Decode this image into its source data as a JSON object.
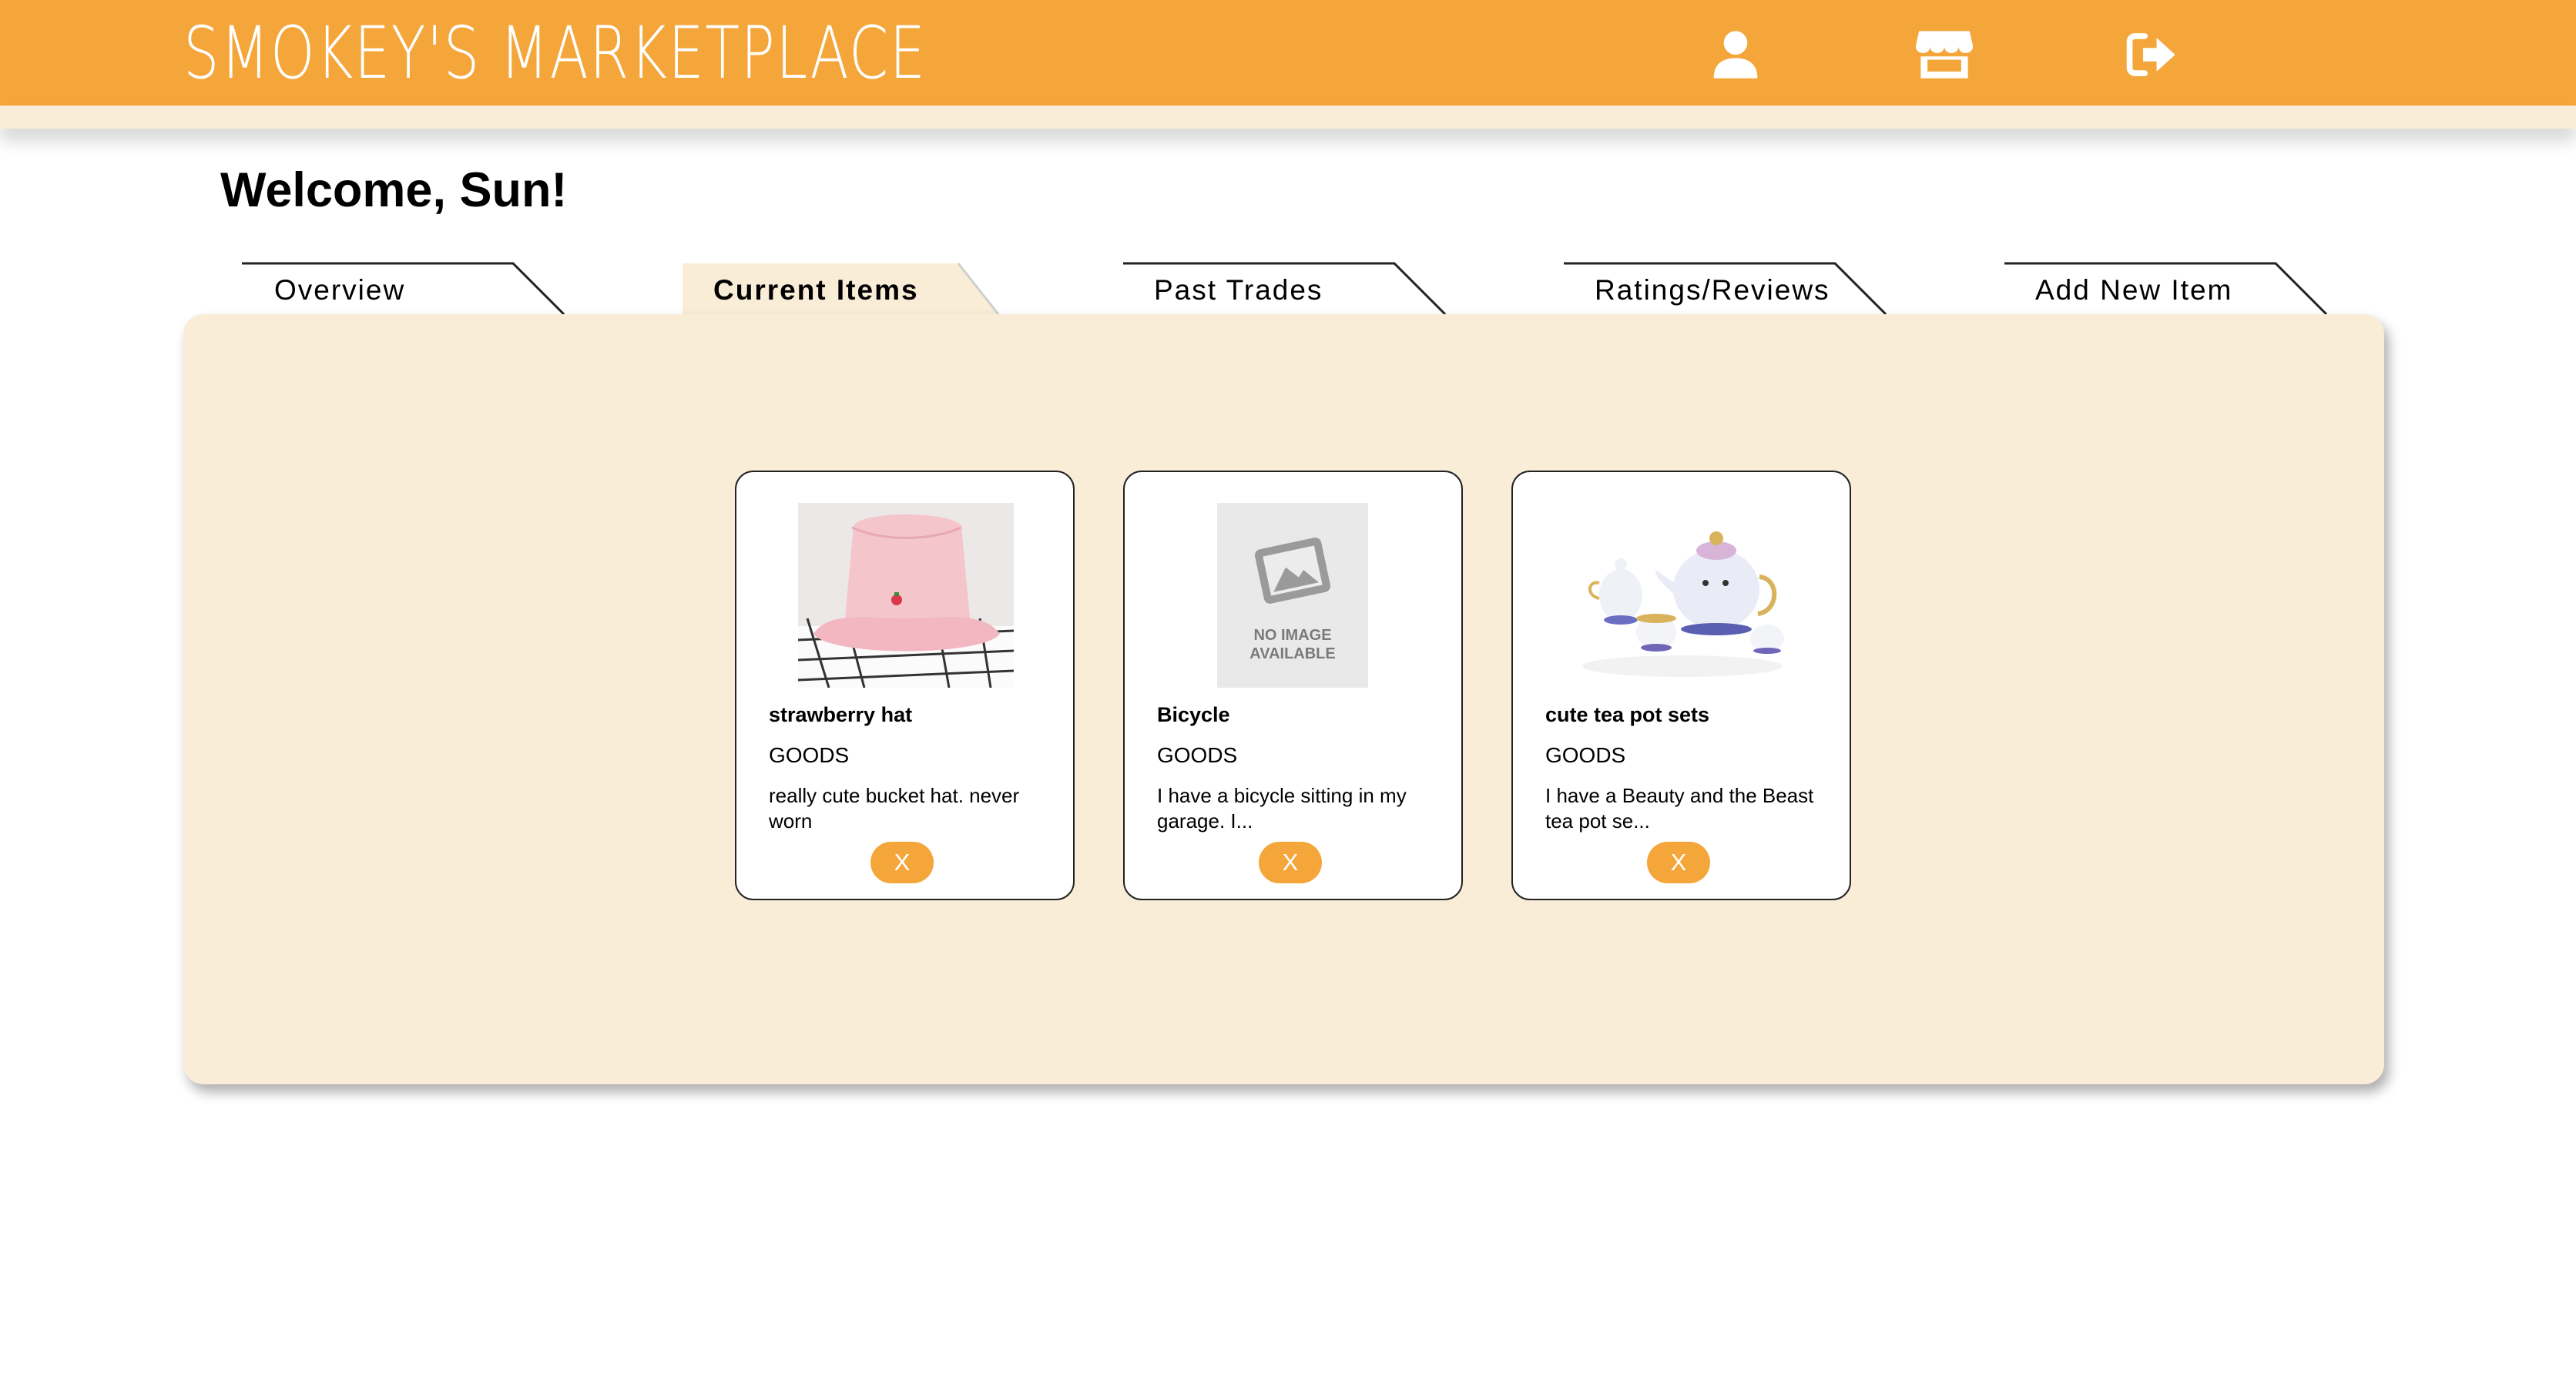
{
  "header": {
    "brand": "SMOKEY'S MARKETPLACE",
    "icons": [
      "user-icon",
      "store-icon",
      "sign-out-icon"
    ]
  },
  "welcome": "Welcome, Sun!",
  "tabs": [
    {
      "label": "Overview",
      "active": false
    },
    {
      "label": "Current Items",
      "active": true
    },
    {
      "label": "Past Trades",
      "active": false
    },
    {
      "label": "Ratings/Reviews",
      "active": false
    },
    {
      "label": "Add New Item",
      "active": false
    }
  ],
  "items": [
    {
      "title": "strawberry hat",
      "category": "GOODS",
      "description": "really cute bucket hat. never worn",
      "remove_label": "X",
      "image": "pink-bucket-hat-photo"
    },
    {
      "title": "Bicycle",
      "category": "GOODS",
      "description": "I have a bicycle sitting in my garage. I...",
      "remove_label": "X",
      "image": "no-image-placeholder",
      "placeholder_text": [
        "NO IMAGE",
        "AVAILABLE"
      ]
    },
    {
      "title": "cute tea pot sets",
      "category": "GOODS",
      "description": "I have a Beauty and the Beast tea pot se...",
      "remove_label": "X",
      "image": "teapot-set-photo"
    }
  ],
  "colors": {
    "accent": "#f4a63b",
    "panel": "#faedd8",
    "white": "#ffffff"
  }
}
